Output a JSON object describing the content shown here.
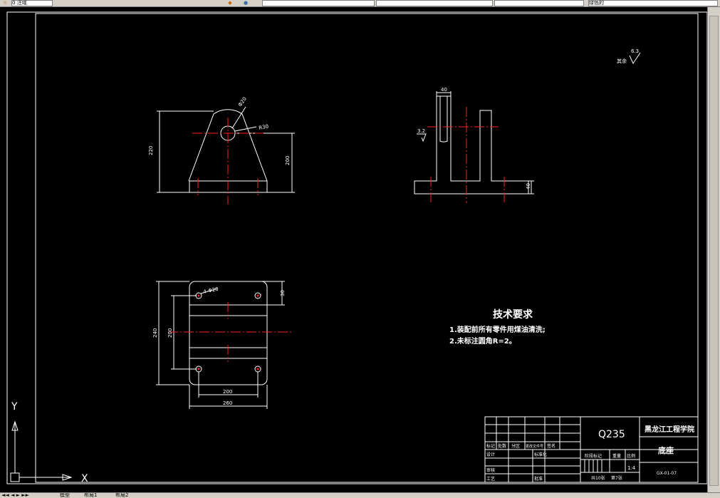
{
  "toolbar": {
    "layer_value": "0 注域",
    "fields": [
      "",
      "",
      "",
      ""
    ],
    "right_field": "绿色的"
  },
  "drawing": {
    "dims_front": {
      "d1": "Φ20",
      "d2": "R30",
      "d3": "220",
      "d4": "200"
    },
    "dims_side": {
      "d1": "40",
      "d2": "40",
      "roughness": "3.2"
    },
    "dims_top": {
      "d1": "4-Φ20",
      "d2": "30",
      "d3": "240",
      "d4": "200",
      "d5": "200",
      "d6": "260"
    },
    "roughness_note": {
      "label": "其余",
      "value": "6.3"
    },
    "tech_req": {
      "title": "技术要求",
      "items": [
        "1.装配前所有零件用煤油清洗;",
        "2.未标注圆角R=2。"
      ]
    },
    "title_block": {
      "material": "Q235",
      "school": "黑龙江工程学院",
      "part_name": "底座",
      "drawing_no": "GX-01-07",
      "scale_label": "比例",
      "scale": "1:4",
      "weight_label": "重量",
      "stage_label": "阶段标记",
      "sheets": "共10张",
      "sheet": "第7张",
      "row_labels": [
        "标记",
        "处数",
        "分区",
        "更改文件号",
        "签名"
      ],
      "design": "设计",
      "standard": "标准化",
      "review": "审核",
      "process": "工艺",
      "approve": "批准"
    },
    "ucs": {
      "x": "X",
      "y": "Y"
    }
  },
  "tabs": [
    "模型",
    "布局1",
    "布局2"
  ]
}
